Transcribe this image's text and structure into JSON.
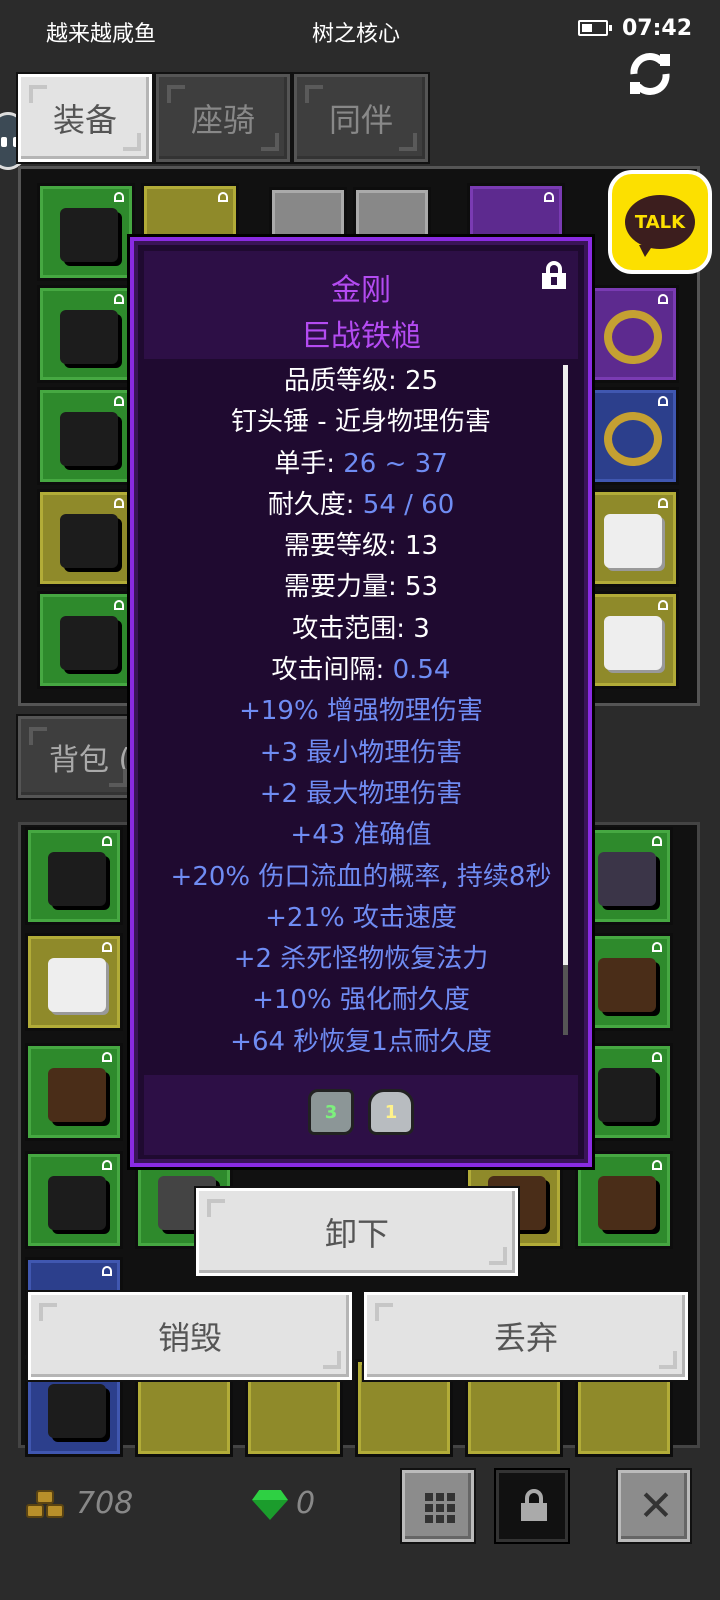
{
  "status_bar": {
    "left_text": "越来越咸鱼",
    "center_text": "树之核心",
    "time": "07:42",
    "battery_icon": "battery-icon"
  },
  "tabs": [
    {
      "label": "装备",
      "active": true
    },
    {
      "label": "座骑",
      "active": false
    },
    {
      "label": "同伴",
      "active": false
    }
  ],
  "backpack_tab": {
    "label": "背包 ("
  },
  "talk_button": {
    "label": "TALK",
    "color": "#fce000"
  },
  "item": {
    "name_line1": "金刚",
    "name_line2": "巨战铁槌",
    "name_color": "#b44bf2",
    "stats": [
      {
        "label": "品质等级: ",
        "value": "25",
        "highlight": false
      },
      {
        "label": "钉头锤 - 近身物理伤害",
        "value": "",
        "highlight": false
      },
      {
        "label": "单手: ",
        "value": "26 ~ 37",
        "highlight": true
      },
      {
        "label": "耐久度: ",
        "value": "54 / 60",
        "highlight": true
      },
      {
        "label": "需要等级: ",
        "value": "13",
        "highlight": false
      },
      {
        "label": "需要力量: ",
        "value": "53",
        "highlight": false
      },
      {
        "label": "攻击范围: ",
        "value": "3",
        "highlight": false
      },
      {
        "label": "攻击间隔: ",
        "value": "0.54",
        "highlight": true
      }
    ],
    "modifiers": [
      "+19% 增强物理伤害",
      "+3 最小物理伤害",
      "+2 最大物理伤害",
      "+43 准确值",
      "+20% 伤口流血的概率, 持续8秒",
      "+21% 攻击速度",
      "+2 杀死怪物恢复法力",
      "+10% 强化耐久度",
      "+64 秒恢复1点耐久度"
    ],
    "socket_gems": [
      {
        "label": "3"
      },
      {
        "label": "1"
      }
    ]
  },
  "actions": {
    "unequip": "卸下",
    "destroy": "销毁",
    "discard": "丢弃"
  },
  "currency": {
    "gold": "708",
    "gems": "0"
  },
  "colors": {
    "accent_purple": "#8a2be2",
    "stat_blue": "#6f8cf3",
    "slot_green": "#2e8a2c"
  }
}
